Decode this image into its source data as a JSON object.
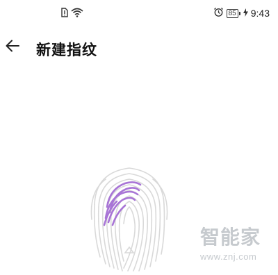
{
  "status_bar": {
    "icons": [
      "sim-alert-icon",
      "wifi-icon",
      "alarm-icon",
      "battery-icon",
      "charging-icon"
    ],
    "battery_level": "85",
    "time": "9:43"
  },
  "header": {
    "back_icon": "arrow-left-icon",
    "title": "新建指纹"
  },
  "fingerprint": {
    "icon": "fingerprint-icon",
    "enrolled_color": "#a874d6",
    "base_color": "#d8d8d8"
  },
  "watermark": {
    "logo": "智能家",
    "url": "www.znj.com"
  }
}
